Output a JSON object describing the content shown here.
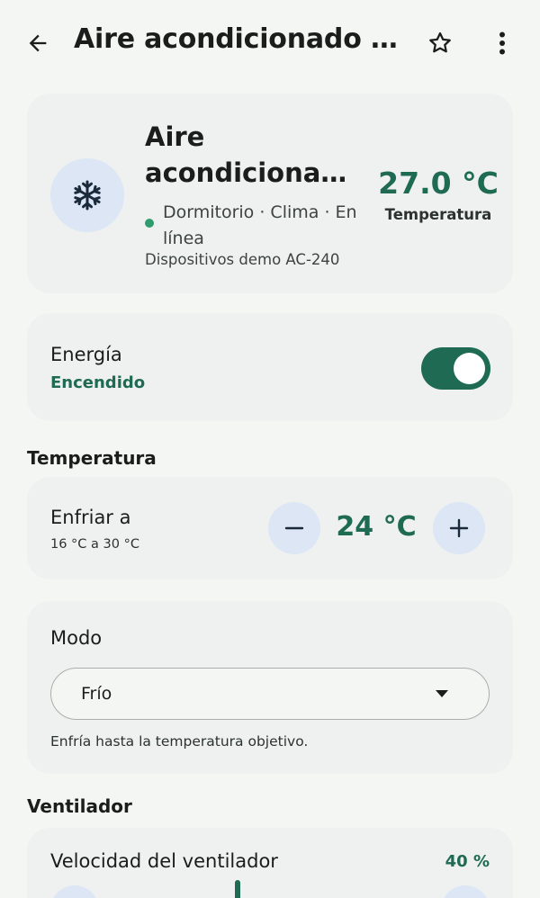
{
  "topbar": {
    "title": "Aire acondicionado del …",
    "back_icon": "arrow-left-icon",
    "favorite_icon": "star-outline-icon",
    "more_icon": "more-vert-icon"
  },
  "device": {
    "name_line1": "Aire",
    "name_line2": "acondicionado …",
    "status_line": "Dormitorio · Clima · En línea",
    "subtitle": "Dispositivos demo AC-240",
    "temperature_value": "27.0 °C",
    "temperature_label": "Temperatura",
    "icon": "snowflake-icon"
  },
  "power": {
    "label": "Energía",
    "status": "Encendido",
    "on": true
  },
  "sections": {
    "temperature": "Temperatura",
    "fan": "Ventilador"
  },
  "setpoint": {
    "label": "Enfriar a",
    "range": "16 °C a 30 °C",
    "value": "24 °C"
  },
  "mode": {
    "label": "Modo",
    "selected": "Frío",
    "description": "Enfría hasta la temperatura objetivo."
  },
  "fan": {
    "label": "Velocidad del ventilador",
    "value": "40 %"
  },
  "colors": {
    "accent": "#1f6a52",
    "status_online": "#2f9c6f",
    "icon_bg": "#dce6f4"
  }
}
